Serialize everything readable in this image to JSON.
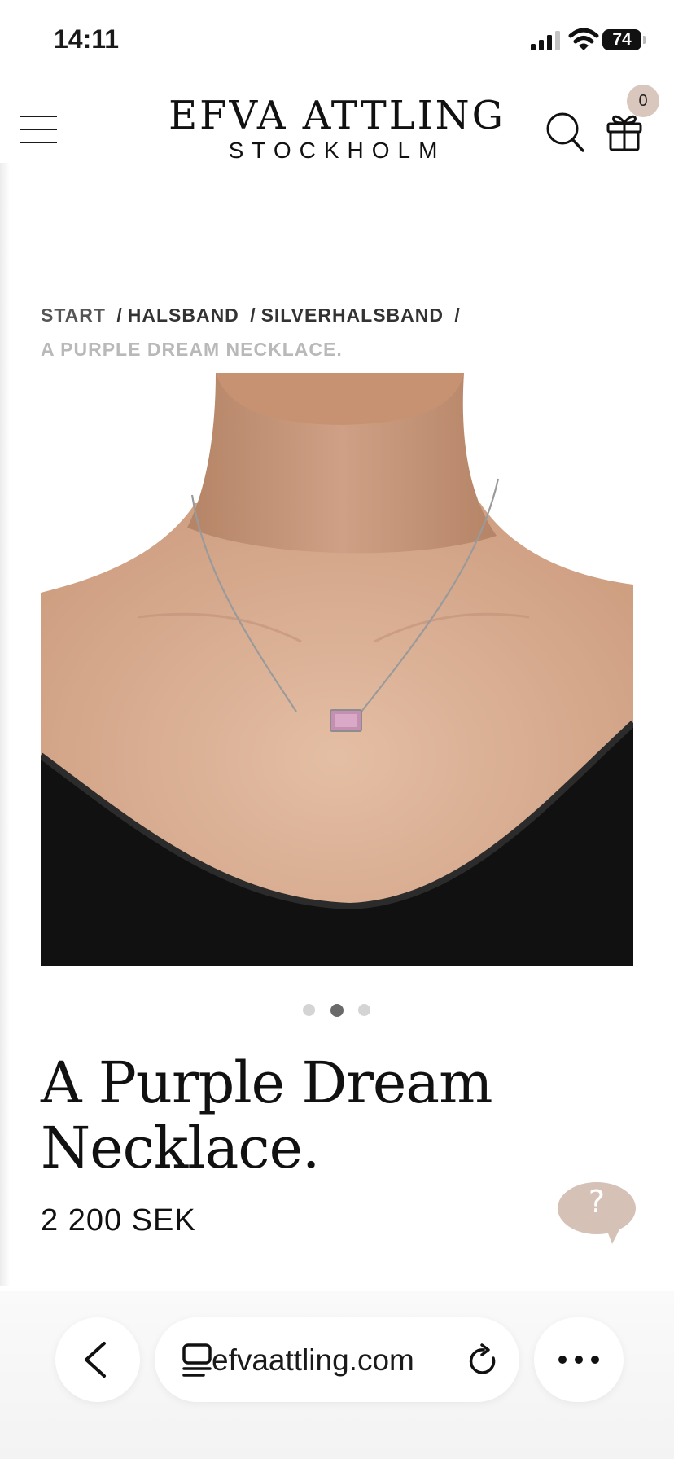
{
  "status_bar": {
    "time": "14:11",
    "battery": "74"
  },
  "header": {
    "brand_line1": "EFVA ATTLING",
    "brand_line2": "STOCKHOLM",
    "cart_count": "0"
  },
  "breadcrumb": {
    "items": [
      "START",
      "HALSBAND",
      "SILVERHALSBAND"
    ],
    "separator": "/",
    "current": "A PURPLE DREAM NECKLACE."
  },
  "product": {
    "title": "A Purple Dream Necklace.",
    "price": "2 200 SEK",
    "image_count": 3,
    "active_image": 2
  },
  "help": {
    "label": "?"
  },
  "browser": {
    "url": "efvaattling.com"
  },
  "colors": {
    "accent_badge": "#d9c6bc",
    "help_bubble": "#d6c1b6",
    "breadcrumb_current": "#b9b9b9"
  }
}
